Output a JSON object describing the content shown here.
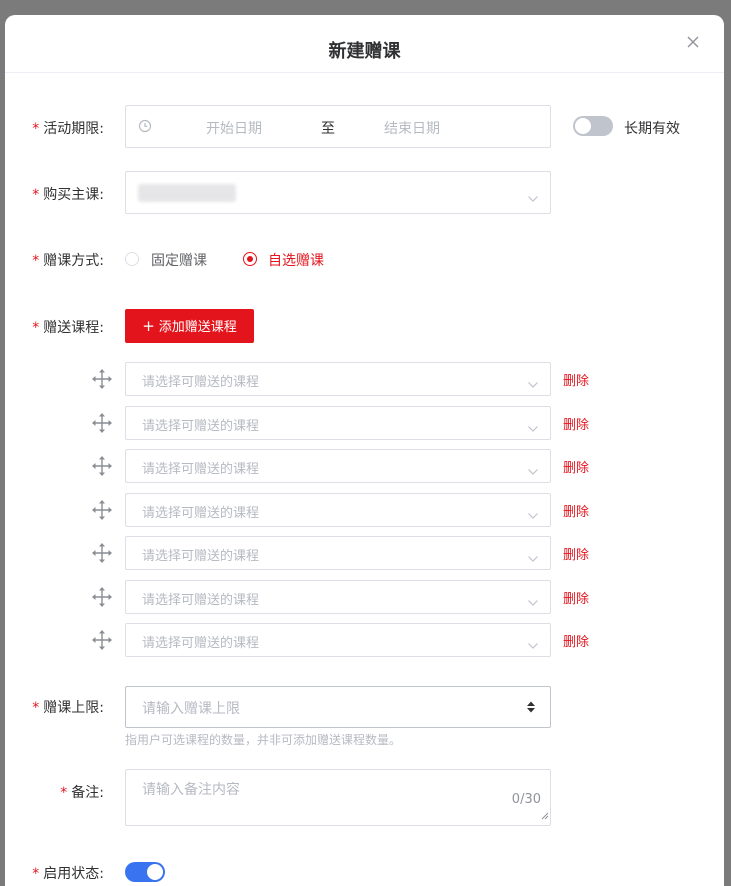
{
  "dialog": {
    "title": "新建赠课"
  },
  "form": {
    "period": {
      "label": "活动期限:",
      "start_placeholder": "开始日期",
      "separator": "至",
      "end_placeholder": "结束日期",
      "long_term_label": "长期有效",
      "long_term_enabled": false
    },
    "main_course": {
      "label": "购买主课:"
    },
    "gift_mode": {
      "label": "赠课方式:",
      "options": [
        "固定赠课",
        "自选赠课"
      ],
      "selected": "自选赠课"
    },
    "gift_courses": {
      "label": "赠送课程:",
      "add_button": "添加赠送课程",
      "add_icon": "+",
      "items": [
        {
          "placeholder": "请选择可赠送的课程",
          "delete": "删除"
        },
        {
          "placeholder": "请选择可赠送的课程",
          "delete": "删除"
        },
        {
          "placeholder": "请选择可赠送的课程",
          "delete": "删除"
        },
        {
          "placeholder": "请选择可赠送的课程",
          "delete": "删除"
        },
        {
          "placeholder": "请选择可赠送的课程",
          "delete": "删除"
        },
        {
          "placeholder": "请选择可赠送的课程",
          "delete": "删除"
        },
        {
          "placeholder": "请选择可赠送的课程",
          "delete": "删除"
        }
      ]
    },
    "limit": {
      "label": "赠课上限:",
      "placeholder": "请输入赠课上限",
      "hint": "指用户可选课程的数量，并非可添加赠送课程数量。"
    },
    "remark": {
      "label": "备注:",
      "placeholder": "请输入备注内容",
      "counter": "0/30"
    },
    "status": {
      "label": "启用状态:",
      "enabled": true
    }
  },
  "colors": {
    "primary": "#e4141c",
    "switch_on": "#3a73f0",
    "switch_off": "#c0c4cc",
    "placeholder": "#b6bac2"
  }
}
